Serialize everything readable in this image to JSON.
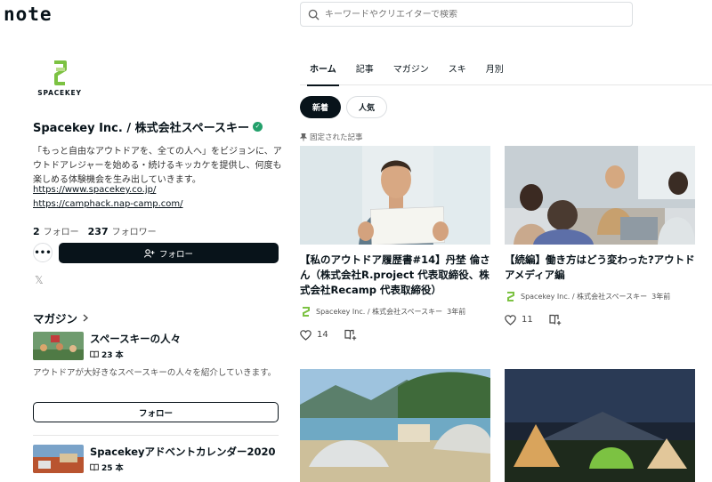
{
  "header": {
    "logo": "note",
    "search_placeholder": "キーワードやクリエイターで検索"
  },
  "profile": {
    "brand_text": "SPACEKEY",
    "name": "Spacekey Inc. / 株式会社スペースキー",
    "bio": "「もっと自由なアウトドアを、全ての人へ」をビジョンに、アウトドアレジャーを始める・続けるキッカケを提供し、何度も楽しめる体験機会を生み出していきます。",
    "links": [
      "https://www.spacekey.co.jp/",
      "https://camphack.nap-camp.com/"
    ],
    "follow_count": "2",
    "follow_label": "フォロー",
    "follower_count": "237",
    "follower_label": "フォロワー",
    "more_label": "•••",
    "follow_button": "フォロー",
    "social_icon": "x-icon"
  },
  "magazines": {
    "heading": "マガジン",
    "items": [
      {
        "title": "スペースキーの人々",
        "count": "23 本",
        "description": "アウトドアが大好きなスペースキーの人々を紹介していきます。",
        "follow_label": "フォロー"
      },
      {
        "title": "Spacekeyアドベントカレンダー2020",
        "count": "25 本"
      }
    ]
  },
  "tabs": [
    {
      "label": "ホーム",
      "active": true
    },
    {
      "label": "記事",
      "active": false
    },
    {
      "label": "マガジン",
      "active": false
    },
    {
      "label": "スキ",
      "active": false
    },
    {
      "label": "月別",
      "active": false
    }
  ],
  "filters": {
    "new": "新着",
    "popular": "人気"
  },
  "pinned_label": "固定された記事",
  "articles": [
    {
      "title": "【私のアウトドア履歴書#14】丹埜 倫さん（株式会社R.project 代表取締役、株式会社Recamp 代表取締役）",
      "author": "Spacekey Inc. / 株式会社スペースキー",
      "age": "3年前",
      "likes": "14"
    },
    {
      "title": "【続編】働き方はどう変わった?アウトドアメディア編",
      "author": "Spacekey Inc. / 株式会社スペースキー",
      "age": "3年前",
      "likes": "11"
    }
  ],
  "colors": {
    "text": "#08131a",
    "verified": "#23a06b",
    "brand_green": "#7cc242"
  }
}
